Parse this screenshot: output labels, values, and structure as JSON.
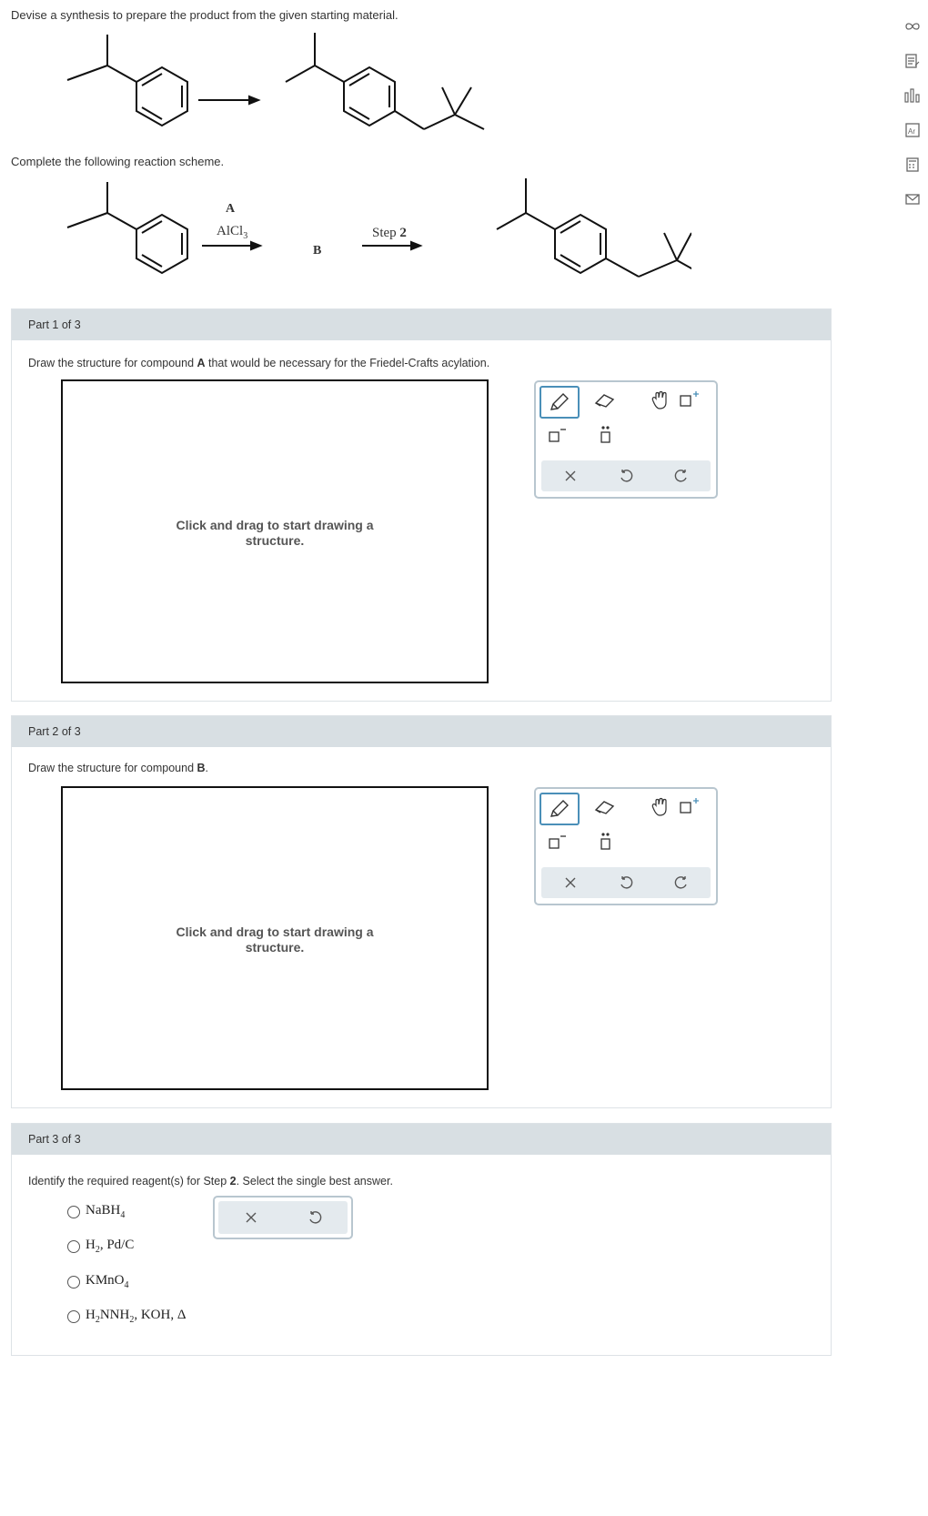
{
  "prompt": {
    "intro": "Devise a synthesis to prepare the product from the given starting material.",
    "scheme": "Complete the following reaction scheme."
  },
  "scheme": {
    "reagent_a": "A",
    "alcl": "AlCl",
    "alcl_sub": "3",
    "intermediate": "B",
    "step2_word": "Step",
    "step2_num": "2"
  },
  "parts": {
    "p1": {
      "header": "Part 1 of 3",
      "q_pre": "Draw the structure for compound ",
      "q_bold": "A",
      "q_post": " that would be necessary for the Friedel-Crafts acylation.",
      "hint": "Click and drag to start drawing a structure."
    },
    "p2": {
      "header": "Part 2 of 3",
      "q_pre": "Draw the structure for compound ",
      "q_bold": "B",
      "q_post": ".",
      "hint": "Click and drag to start drawing a structure."
    },
    "p3": {
      "header": "Part 3 of 3",
      "q_pre": "Identify the required reagent(s) for Step ",
      "q_bold": "2",
      "q_post": ". Select the single best answer."
    }
  },
  "options": [
    {
      "main": "NaBH",
      "sub": "4",
      "rest": ""
    },
    {
      "main": "H",
      "sub": "2",
      "rest": ", Pd/C"
    },
    {
      "main": "KMnO",
      "sub": "4",
      "rest": ""
    },
    {
      "main": "H",
      "sub": "2",
      "rest": "NNH",
      "sub2": "2",
      "rest2": ", KOH, Δ"
    }
  ],
  "colors": {
    "header_bg": "#d8dfe3",
    "tool_border": "#b8c6cf",
    "accent": "#4a8fb8"
  }
}
